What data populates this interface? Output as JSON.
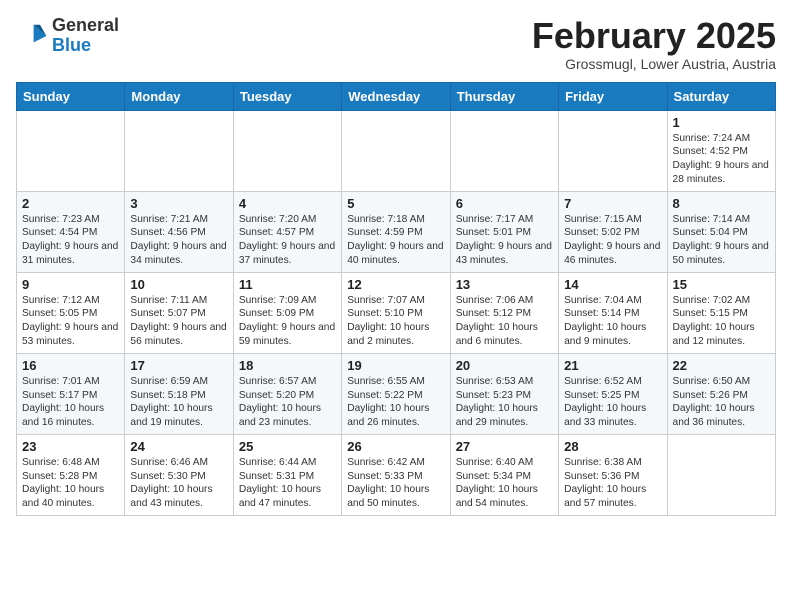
{
  "header": {
    "logo_general": "General",
    "logo_blue": "Blue",
    "month_title": "February 2025",
    "subtitle": "Grossmugl, Lower Austria, Austria"
  },
  "days_of_week": [
    "Sunday",
    "Monday",
    "Tuesday",
    "Wednesday",
    "Thursday",
    "Friday",
    "Saturday"
  ],
  "weeks": [
    [
      {
        "day": "",
        "info": ""
      },
      {
        "day": "",
        "info": ""
      },
      {
        "day": "",
        "info": ""
      },
      {
        "day": "",
        "info": ""
      },
      {
        "day": "",
        "info": ""
      },
      {
        "day": "",
        "info": ""
      },
      {
        "day": "1",
        "info": "Sunrise: 7:24 AM\nSunset: 4:52 PM\nDaylight: 9 hours and 28 minutes."
      }
    ],
    [
      {
        "day": "2",
        "info": "Sunrise: 7:23 AM\nSunset: 4:54 PM\nDaylight: 9 hours and 31 minutes."
      },
      {
        "day": "3",
        "info": "Sunrise: 7:21 AM\nSunset: 4:56 PM\nDaylight: 9 hours and 34 minutes."
      },
      {
        "day": "4",
        "info": "Sunrise: 7:20 AM\nSunset: 4:57 PM\nDaylight: 9 hours and 37 minutes."
      },
      {
        "day": "5",
        "info": "Sunrise: 7:18 AM\nSunset: 4:59 PM\nDaylight: 9 hours and 40 minutes."
      },
      {
        "day": "6",
        "info": "Sunrise: 7:17 AM\nSunset: 5:01 PM\nDaylight: 9 hours and 43 minutes."
      },
      {
        "day": "7",
        "info": "Sunrise: 7:15 AM\nSunset: 5:02 PM\nDaylight: 9 hours and 46 minutes."
      },
      {
        "day": "8",
        "info": "Sunrise: 7:14 AM\nSunset: 5:04 PM\nDaylight: 9 hours and 50 minutes."
      }
    ],
    [
      {
        "day": "9",
        "info": "Sunrise: 7:12 AM\nSunset: 5:05 PM\nDaylight: 9 hours and 53 minutes."
      },
      {
        "day": "10",
        "info": "Sunrise: 7:11 AM\nSunset: 5:07 PM\nDaylight: 9 hours and 56 minutes."
      },
      {
        "day": "11",
        "info": "Sunrise: 7:09 AM\nSunset: 5:09 PM\nDaylight: 9 hours and 59 minutes."
      },
      {
        "day": "12",
        "info": "Sunrise: 7:07 AM\nSunset: 5:10 PM\nDaylight: 10 hours and 2 minutes."
      },
      {
        "day": "13",
        "info": "Sunrise: 7:06 AM\nSunset: 5:12 PM\nDaylight: 10 hours and 6 minutes."
      },
      {
        "day": "14",
        "info": "Sunrise: 7:04 AM\nSunset: 5:14 PM\nDaylight: 10 hours and 9 minutes."
      },
      {
        "day": "15",
        "info": "Sunrise: 7:02 AM\nSunset: 5:15 PM\nDaylight: 10 hours and 12 minutes."
      }
    ],
    [
      {
        "day": "16",
        "info": "Sunrise: 7:01 AM\nSunset: 5:17 PM\nDaylight: 10 hours and 16 minutes."
      },
      {
        "day": "17",
        "info": "Sunrise: 6:59 AM\nSunset: 5:18 PM\nDaylight: 10 hours and 19 minutes."
      },
      {
        "day": "18",
        "info": "Sunrise: 6:57 AM\nSunset: 5:20 PM\nDaylight: 10 hours and 23 minutes."
      },
      {
        "day": "19",
        "info": "Sunrise: 6:55 AM\nSunset: 5:22 PM\nDaylight: 10 hours and 26 minutes."
      },
      {
        "day": "20",
        "info": "Sunrise: 6:53 AM\nSunset: 5:23 PM\nDaylight: 10 hours and 29 minutes."
      },
      {
        "day": "21",
        "info": "Sunrise: 6:52 AM\nSunset: 5:25 PM\nDaylight: 10 hours and 33 minutes."
      },
      {
        "day": "22",
        "info": "Sunrise: 6:50 AM\nSunset: 5:26 PM\nDaylight: 10 hours and 36 minutes."
      }
    ],
    [
      {
        "day": "23",
        "info": "Sunrise: 6:48 AM\nSunset: 5:28 PM\nDaylight: 10 hours and 40 minutes."
      },
      {
        "day": "24",
        "info": "Sunrise: 6:46 AM\nSunset: 5:30 PM\nDaylight: 10 hours and 43 minutes."
      },
      {
        "day": "25",
        "info": "Sunrise: 6:44 AM\nSunset: 5:31 PM\nDaylight: 10 hours and 47 minutes."
      },
      {
        "day": "26",
        "info": "Sunrise: 6:42 AM\nSunset: 5:33 PM\nDaylight: 10 hours and 50 minutes."
      },
      {
        "day": "27",
        "info": "Sunrise: 6:40 AM\nSunset: 5:34 PM\nDaylight: 10 hours and 54 minutes."
      },
      {
        "day": "28",
        "info": "Sunrise: 6:38 AM\nSunset: 5:36 PM\nDaylight: 10 hours and 57 minutes."
      },
      {
        "day": "",
        "info": ""
      }
    ]
  ]
}
